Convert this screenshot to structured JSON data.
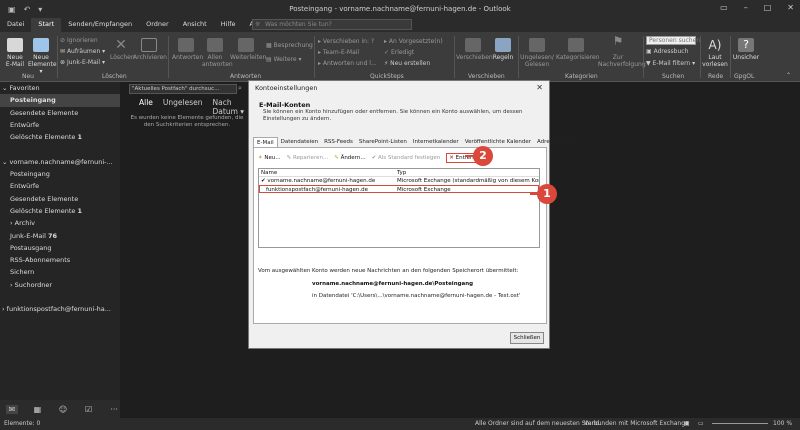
{
  "window": {
    "title": "Posteingang - vorname.nachname@fernuni-hagen.de - Outlook"
  },
  "menu": {
    "tabs": [
      "Datei",
      "Start",
      "Senden/Empfangen",
      "Ordner",
      "Ansicht",
      "Hilfe",
      "Acrobat"
    ],
    "active": "Start"
  },
  "search": {
    "placeholder": "Was möchten Sie tun?"
  },
  "ribbon": {
    "neu": {
      "email": "Neue E-Mail",
      "elemente": "Neue Elemente ▾",
      "group": "Neu"
    },
    "loeschen": {
      "ignorieren": "Ignorieren",
      "aufraeumen": "Aufräumen ▾",
      "junk": "Junk-E-Mail ▾",
      "loeschen": "Löschen",
      "archivieren": "Archivieren",
      "group": "Löschen"
    },
    "antworten": {
      "antworten": "Antworten",
      "allen": "Allen antworten",
      "weiterleiten": "Weiterleiten",
      "besprechung": "Besprechung",
      "weitere": "Weitere ▾",
      "group": "Antworten"
    },
    "quicksteps": {
      "verschieben": "Verschieben in: ?",
      "team": "Team-E-Mail",
      "antworten": "Antworten und l...",
      "vorgesetzte": "An Vorgesetzte(n)",
      "erledigt": "Erledigt",
      "neu": "Neu erstellen",
      "group": "QuickSteps"
    },
    "verschieben": {
      "verschieben": "Verschieben",
      "regeln": "Regeln",
      "group": "Verschieben"
    },
    "kategorien": {
      "ungelesen": "Ungelesen/ Gelesen",
      "kategorisieren": "Kategorisieren",
      "nachverfolgung": "Zur Nachverfolgung",
      "group": "Kategorien"
    },
    "suchen": {
      "personen": "Personen suchen",
      "adressbuch": "Adressbuch",
      "filtern": "E-Mail filtern ▾",
      "group": "Suchen"
    },
    "rede": {
      "laut": "Laut vorlesen",
      "group": "Rede"
    },
    "gpgol": {
      "unsicher": "Unsicher",
      "group": "GpgOL"
    }
  },
  "sidebar": {
    "items": [
      {
        "label": "Favoriten",
        "type": "hdr"
      },
      {
        "label": "Posteingang",
        "type": "sel"
      },
      {
        "label": "Gesendete Elemente",
        "type": ""
      },
      {
        "label": "Entwürfe",
        "type": ""
      },
      {
        "label": "Gelöschte Elemente",
        "count": "1",
        "type": ""
      },
      {
        "label": "",
        "type": ""
      },
      {
        "label": "vorname.nachname@fernuni-...",
        "type": "hdr"
      },
      {
        "label": "Posteingang",
        "type": ""
      },
      {
        "label": "Entwürfe",
        "type": ""
      },
      {
        "label": "Gesendete Elemente",
        "type": ""
      },
      {
        "label": "Gelöschte Elemente",
        "count": "1",
        "type": ""
      },
      {
        "label": "Archiv",
        "type": ""
      },
      {
        "label": "Junk-E-Mail",
        "count": "76",
        "type": ""
      },
      {
        "label": "Postausgang",
        "type": ""
      },
      {
        "label": "RSS-Abonnements",
        "type": ""
      },
      {
        "label": "Sichern",
        "type": ""
      },
      {
        "label": "Suchordner",
        "type": ""
      },
      {
        "label": "",
        "type": ""
      },
      {
        "label": "funktionspostfach@fernuni-ha...",
        "type": "hdr"
      }
    ]
  },
  "maillist": {
    "scope": "\"Aktuelles Postfach\" durchsuc...",
    "tab_all": "Alle",
    "tab_unread": "Ungelesen",
    "sort": "Nach Datum ▾",
    "empty": "Es wurden keine Elemente gefunden, die den Suchkriterien entsprechen."
  },
  "status": {
    "left": "Elemente: 0",
    "sync": "Alle Ordner sind auf dem neuesten Stand.",
    "conn": "Verbunden mit Microsoft Exchange",
    "zoom": "100 %"
  },
  "dialog": {
    "title": "Kontoeinstellungen",
    "heading": "E-Mail-Konten",
    "desc": "Sie können ein Konto hinzufügen oder entfernen. Sie können ein Konto auswählen, um dessen Einstellungen zu ändern.",
    "tabs": [
      "E-Mail",
      "Datendateien",
      "RSS-Feeds",
      "SharePoint-Listen",
      "Internetkalender",
      "Veröffentlichte Kalender",
      "Adressbücher"
    ],
    "toolbar": {
      "neu": "Neu...",
      "reparieren": "Reparieren...",
      "aendern": "Ändern...",
      "standard": "Als Standard festlegen",
      "entfernen": "Entfernen"
    },
    "col_name": "Name",
    "col_type": "Typ",
    "accounts": [
      {
        "name": "vorname.nachname@fernuni-hagen.de",
        "type": "Microsoft Exchange (standardmäßig von diesem Kon..."
      },
      {
        "name": "funktionspostfach@fernuni-hagen.de",
        "type": "Microsoft Exchange"
      }
    ],
    "delivery_info": "Vom ausgewählten Konto werden neue Nachrichten an den folgenden Speicherort übermittelt:",
    "delivery_folder": "vorname.nachname@fernuni-hagen.de\\Posteingang",
    "delivery_file": "in Datendatei 'C:\\Users\\...\\vorname.nachname@fernuni-hagen.de - Test.ost'",
    "close": "Schließen"
  },
  "markers": {
    "one": "1",
    "two": "2"
  },
  "colors": {
    "accent": "#d9483b",
    "ribbon": "#3c3c3c",
    "dark": "#1e1e1e"
  }
}
